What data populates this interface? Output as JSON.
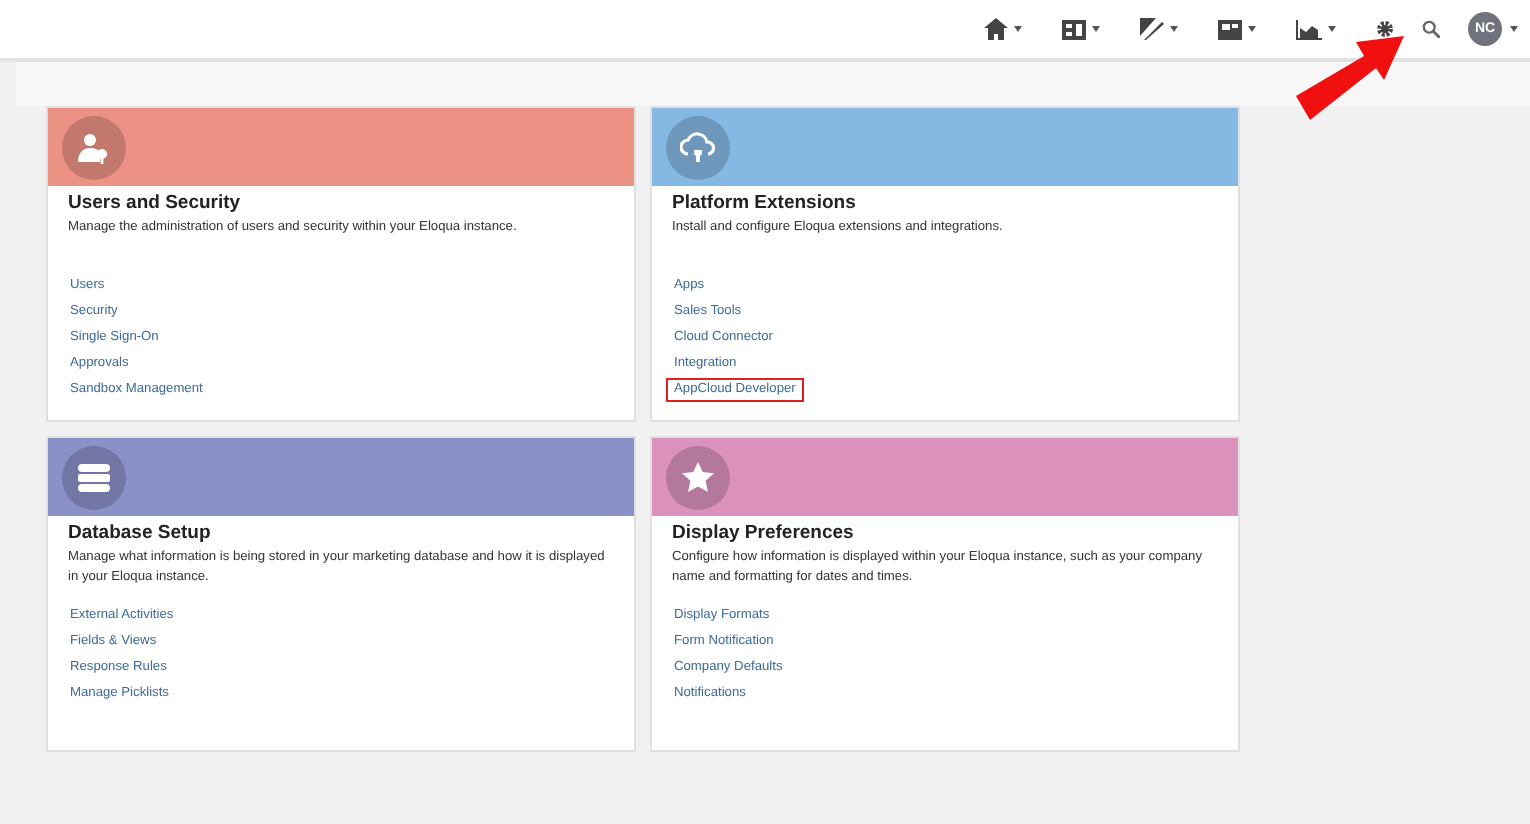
{
  "top_nav": {
    "menus": [
      {
        "kind": "home"
      },
      {
        "kind": "dashboard"
      },
      {
        "kind": "pen"
      },
      {
        "kind": "image"
      },
      {
        "kind": "chart"
      }
    ],
    "avatar": "NC",
    "callout_arrow": true
  },
  "cards": [
    {
      "title": "Users and Security",
      "color": "#ec9285",
      "kind": "user-key",
      "description": "Manage the administration of users and security within your Eloqua instance.",
      "links": [
        {
          "label": "Users",
          "highlighted": false
        },
        {
          "label": "Security",
          "highlighted": false
        },
        {
          "label": "Single Sign-On",
          "highlighted": false
        },
        {
          "label": "Approvals",
          "highlighted": false
        },
        {
          "label": "Sandbox Management",
          "highlighted": false
        }
      ]
    },
    {
      "title": "Platform Extensions",
      "color": "#85b9e4",
      "kind": "cloud",
      "description": "Install and configure Eloqua extensions and integrations.",
      "links": [
        {
          "label": "Apps",
          "highlighted": false
        },
        {
          "label": "Sales Tools",
          "highlighted": false
        },
        {
          "label": "Cloud Connector",
          "highlighted": false
        },
        {
          "label": "Integration",
          "highlighted": false
        },
        {
          "label": "AppCloud Developer",
          "highlighted": true
        }
      ]
    },
    {
      "title": "Database Setup",
      "color": "#8a90c8",
      "kind": "database",
      "description": "Manage what information is being stored in your marketing database and how it is displayed in your Eloqua instance.",
      "links": [
        {
          "label": "External Activities",
          "highlighted": false
        },
        {
          "label": "Fields & Views",
          "highlighted": false
        },
        {
          "label": "Response Rules",
          "highlighted": false
        },
        {
          "label": "Manage Picklists",
          "highlighted": false
        }
      ]
    },
    {
      "title": "Display Preferences",
      "color": "#da92bd",
      "kind": "star",
      "description": "Configure how information is displayed within your Eloqua instance, such as your company name and formatting for dates and times.",
      "links": [
        {
          "label": "Display Formats",
          "highlighted": false
        },
        {
          "label": "Form Notification",
          "highlighted": false
        },
        {
          "label": "Company Defaults",
          "highlighted": false
        },
        {
          "label": "Notifications",
          "highlighted": false
        }
      ]
    }
  ]
}
